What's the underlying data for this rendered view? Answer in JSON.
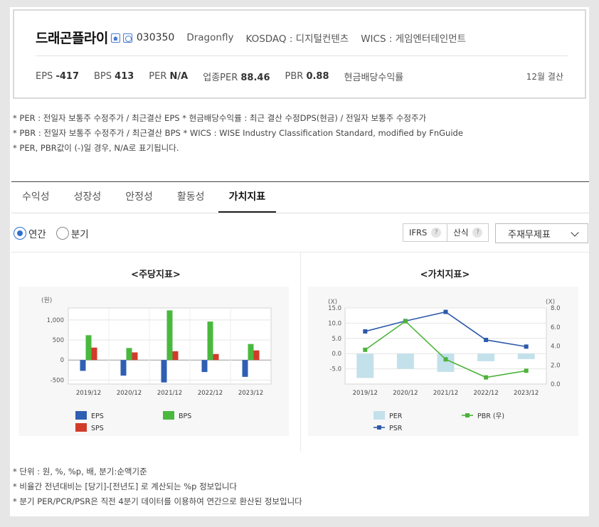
{
  "header": {
    "name": "드래곤플라이",
    "code": "030350",
    "english_name": "Dragonfly",
    "market": "KOSDAQ : 디지털컨텐츠",
    "wics": "WICS : 게임엔터테인먼트",
    "fiscal": "12월 결산",
    "stats": [
      {
        "label": "EPS",
        "value": "-417"
      },
      {
        "label": "BPS",
        "value": "413"
      },
      {
        "label": "PER",
        "value": "N/A"
      },
      {
        "label": "업종PER",
        "value": "88.46"
      },
      {
        "label": "PBR",
        "value": "0.88"
      },
      {
        "label": "현금배당수익률",
        "value": ""
      }
    ]
  },
  "notes_top": [
    "* PER : 전일자 보통주 수정주가 / 최근결산 EPS * 현금배당수익률 : 최근 결산 수정DPS(현금) / 전일자 보통주 수정주가",
    "* PBR : 전일자 보통주 수정주가 / 최근결산 BPS * WICS : WISE Industry Classification Standard, modified by FnGuide",
    "* PER, PBR값이 (-)일 경우, N/A로 표기됩니다."
  ],
  "tabs": [
    {
      "label": "수익성",
      "active": false
    },
    {
      "label": "성장성",
      "active": false
    },
    {
      "label": "안정성",
      "active": false
    },
    {
      "label": "활동성",
      "active": false
    },
    {
      "label": "가치지표",
      "active": true
    }
  ],
  "period": {
    "annual": "연간",
    "quarter": "분기",
    "selected": "annual"
  },
  "buttons": {
    "ifrs": "IFRS",
    "formula": "산식",
    "help_icon": "question-icon"
  },
  "select": {
    "value": "주재무제표"
  },
  "colors": {
    "eps": "#2f5fb3",
    "bps": "#49b93e",
    "sps": "#d23b2a",
    "per": "#c3e1ea",
    "pbr": "#4cb33a",
    "psr": "#2d5aa8"
  },
  "chart_data": [
    {
      "type": "bar",
      "title": "<주당지표>",
      "unit": "(원)",
      "categories": [
        "2019/12",
        "2020/12",
        "2021/12",
        "2022/12",
        "2023/12"
      ],
      "ylim": [
        -600,
        1300
      ],
      "yticks": [
        -500,
        0,
        500,
        1000
      ],
      "ytick_labels": [
        "-500",
        "0",
        "500",
        "1,000"
      ],
      "grid": true,
      "legend": "bottom",
      "series": [
        {
          "name": "EPS",
          "values": [
            -270,
            -390,
            -560,
            -300,
            -420
          ]
        },
        {
          "name": "BPS",
          "values": [
            620,
            300,
            1240,
            960,
            400
          ]
        },
        {
          "name": "SPS",
          "values": [
            310,
            190,
            220,
            150,
            240
          ]
        }
      ]
    },
    {
      "type": "line",
      "title": "<가치지표>",
      "unit_left": "(X)",
      "unit_right": "(X)",
      "categories": [
        "2019/12",
        "2020/12",
        "2021/12",
        "2022/12",
        "2023/12"
      ],
      "ylim_left": [
        -10,
        15
      ],
      "yticks_left": [
        -5,
        0,
        5,
        10,
        15
      ],
      "ytick_labels_left": [
        "-5.0",
        "0.0",
        "5.0",
        "10.0",
        "15.0"
      ],
      "ylim_right": [
        0,
        8
      ],
      "yticks_right": [
        0,
        2,
        4,
        6,
        8
      ],
      "ytick_labels_right": [
        "0.0",
        "2.0",
        "4.0",
        "6.0",
        "8.0"
      ],
      "grid": true,
      "legend": "bottom",
      "series": [
        {
          "name": "PER",
          "kind": "bar",
          "axis": "left",
          "values": [
            -8,
            -5,
            -6,
            -2.5,
            -1.8
          ]
        },
        {
          "name": "PBR (우)",
          "kind": "line",
          "axis": "right",
          "values": [
            3.6,
            6.6,
            2.6,
            0.7,
            1.4
          ]
        },
        {
          "name": "PSR",
          "kind": "line",
          "axis": "left",
          "values": [
            7.3,
            10.7,
            13.7,
            4.5,
            2.3
          ]
        }
      ]
    }
  ],
  "notes_bottom": [
    "* 단위 : 원, %, %p, 배, 분기:순액기준",
    "* 비율간 전년대비는 [당기]-[전년도] 로 계산되는 %p 정보입니다",
    "* 분기 PER/PCR/PSR은 직전 4분기 데이터를 이용하여 연간으로 환산된 정보입니다"
  ]
}
